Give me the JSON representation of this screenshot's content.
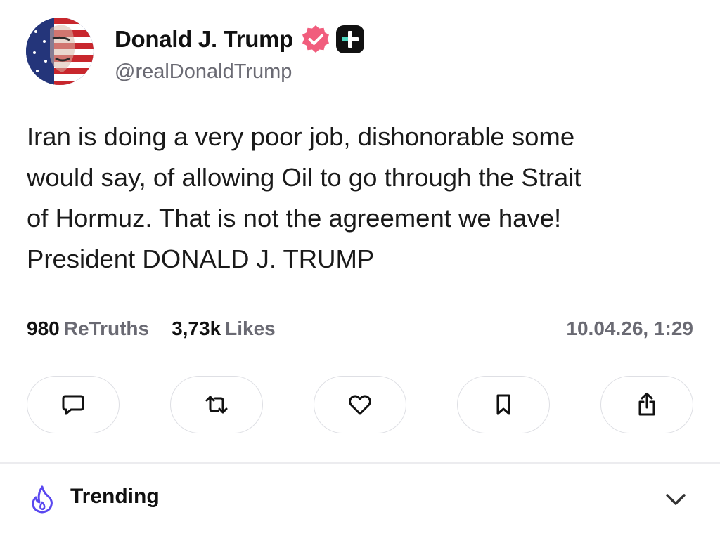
{
  "author": {
    "display_name": "Donald J. Trump",
    "handle": "@realDonaldTrump",
    "avatar": "avatar-american-flag-portrait",
    "verified_badge": "verified-icon",
    "plus_badge": "plus-badge-icon",
    "colors": {
      "verified": "#f15d7d",
      "plus_badge_bg": "#111111",
      "plus_badge_fg": "#4cd7c0"
    }
  },
  "post": {
    "lines": [
      "Iran is doing a very poor job, dishonorable some",
      "would say, of allowing Oil to go through the Strait",
      "of Hormuz. That is not the agreement we have!",
      "President DONALD J. TRUMP"
    ]
  },
  "stats": {
    "retruths_count": "980",
    "retruths_label": "ReTruths",
    "likes_count": "3,73k",
    "likes_label": "Likes",
    "timestamp": "10.04.26, 1:29"
  },
  "actions": [
    {
      "name": "reply",
      "icon": "comment-icon"
    },
    {
      "name": "retruth",
      "icon": "retruth-icon"
    },
    {
      "name": "like",
      "icon": "heart-icon"
    },
    {
      "name": "bookmark",
      "icon": "bookmark-icon"
    },
    {
      "name": "share",
      "icon": "share-icon"
    }
  ],
  "trending": {
    "label": "Trending",
    "icon": "flame-icon",
    "expand_icon": "chevron-down-icon",
    "colors": {
      "flame": "#5a48f0"
    }
  }
}
